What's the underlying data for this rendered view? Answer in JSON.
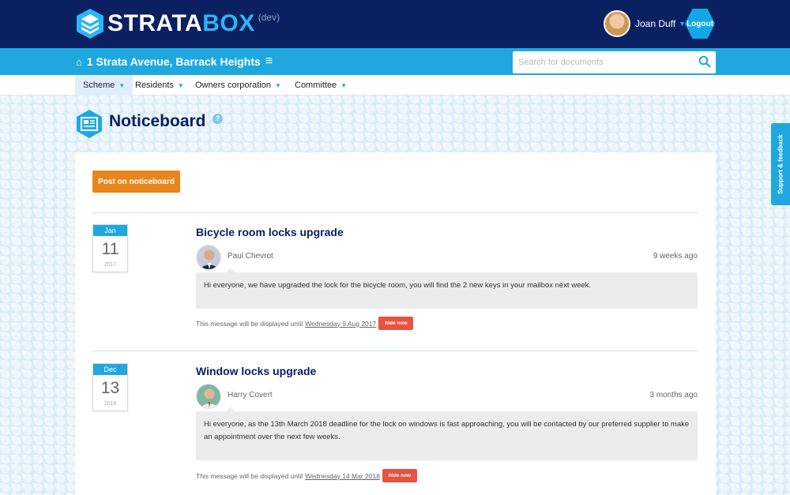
{
  "header": {
    "logo_strata": "STRATA",
    "logo_box": "BOX",
    "env_label": "(dev)",
    "user_name": "Joan Duff",
    "logout_label": "Logout"
  },
  "address_bar": {
    "address": "1 Strata Avenue, Barrack Heights",
    "search_placeholder": "Search for documents"
  },
  "nav": {
    "items": [
      {
        "label": "Scheme"
      },
      {
        "label": "Residents"
      },
      {
        "label": "Owners corporation"
      },
      {
        "label": "Committee"
      }
    ]
  },
  "page": {
    "title": "Noticeboard",
    "help_mark": "?",
    "feedback_label": "Support & feedback",
    "post_button": "Post on noticeboard"
  },
  "notices": [
    {
      "month": "Jan",
      "day": "11",
      "year": "2017",
      "title": "Bicycle room locks upgrade",
      "author": "Paul Chevrot",
      "time_ago": "9 weeks ago",
      "message": "Hi everyone, we have upgraded the lock for the bicycle room, you will find the 2 new keys in your mailbox next week.",
      "until_prefix": "This message will be displayed until",
      "until_date": "Wednesday 9 Aug 2017",
      "hide_label": "hide now"
    },
    {
      "month": "Dec",
      "day": "13",
      "year": "2016",
      "title": "Window locks upgrade",
      "author": "Harry Covert",
      "time_ago": "3 months ago",
      "message": "Hi everyone, as the 13th March 2018 deadline for the lock on windows is fast approaching, you will be contacted by our preferred supplier to make an appointment over the next few weeks.",
      "until_prefix": "This message will be displayed until",
      "until_date": "Wednesday 14 Mar 2018",
      "hide_label": "hide now"
    }
  ],
  "colors": {
    "navy": "#0a2060",
    "accent": "#1fa8e0",
    "orange": "#e8861c",
    "red": "#e55343"
  }
}
